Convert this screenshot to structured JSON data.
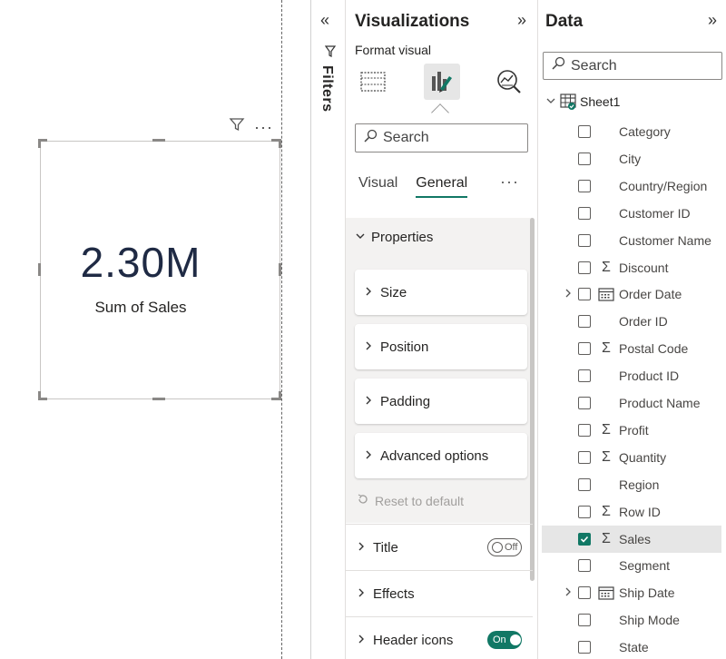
{
  "canvas": {
    "card_value": "2.30M",
    "card_label": "Sum of Sales",
    "header_more": "···"
  },
  "filters": {
    "label": "Filters",
    "collapse_icon": "«"
  },
  "visualizations": {
    "title": "Visualizations",
    "expand_icon": "»",
    "subtitle": "Format visual",
    "search_placeholder": "Search",
    "tabs": [
      {
        "label": "Visual",
        "active": false
      },
      {
        "label": "General",
        "active": true
      }
    ],
    "tabs_more": "···",
    "properties_label": "Properties",
    "groups": [
      "Size",
      "Position",
      "Padding",
      "Advanced options"
    ],
    "reset_label": "Reset to default",
    "sections": [
      {
        "label": "Title",
        "toggle": "Off"
      },
      {
        "label": "Effects",
        "toggle": ""
      },
      {
        "label": "Header icons",
        "toggle": "On"
      }
    ],
    "accent_color": "#117865"
  },
  "data_pane": {
    "title": "Data",
    "expand_icon": "»",
    "search_placeholder": "Search",
    "table_name": "Sheet1",
    "fields": [
      {
        "name": "Category",
        "type": "text",
        "checked": false,
        "expandable": false
      },
      {
        "name": "City",
        "type": "text",
        "checked": false,
        "expandable": false
      },
      {
        "name": "Country/Region",
        "type": "text",
        "checked": false,
        "expandable": false
      },
      {
        "name": "Customer ID",
        "type": "text",
        "checked": false,
        "expandable": false
      },
      {
        "name": "Customer Name",
        "type": "text",
        "checked": false,
        "expandable": false
      },
      {
        "name": "Discount",
        "type": "sum",
        "checked": false,
        "expandable": false
      },
      {
        "name": "Order Date",
        "type": "date",
        "checked": false,
        "expandable": true
      },
      {
        "name": "Order ID",
        "type": "text",
        "checked": false,
        "expandable": false
      },
      {
        "name": "Postal Code",
        "type": "sum",
        "checked": false,
        "expandable": false
      },
      {
        "name": "Product ID",
        "type": "text",
        "checked": false,
        "expandable": false
      },
      {
        "name": "Product Name",
        "type": "text",
        "checked": false,
        "expandable": false
      },
      {
        "name": "Profit",
        "type": "sum",
        "checked": false,
        "expandable": false
      },
      {
        "name": "Quantity",
        "type": "sum",
        "checked": false,
        "expandable": false
      },
      {
        "name": "Region",
        "type": "text",
        "checked": false,
        "expandable": false
      },
      {
        "name": "Row ID",
        "type": "sum",
        "checked": false,
        "expandable": false
      },
      {
        "name": "Sales",
        "type": "sum",
        "checked": true,
        "expandable": false
      },
      {
        "name": "Segment",
        "type": "text",
        "checked": false,
        "expandable": false
      },
      {
        "name": "Ship Date",
        "type": "date",
        "checked": false,
        "expandable": true
      },
      {
        "name": "Ship Mode",
        "type": "text",
        "checked": false,
        "expandable": false
      },
      {
        "name": "State",
        "type": "text",
        "checked": false,
        "expandable": false
      }
    ]
  }
}
